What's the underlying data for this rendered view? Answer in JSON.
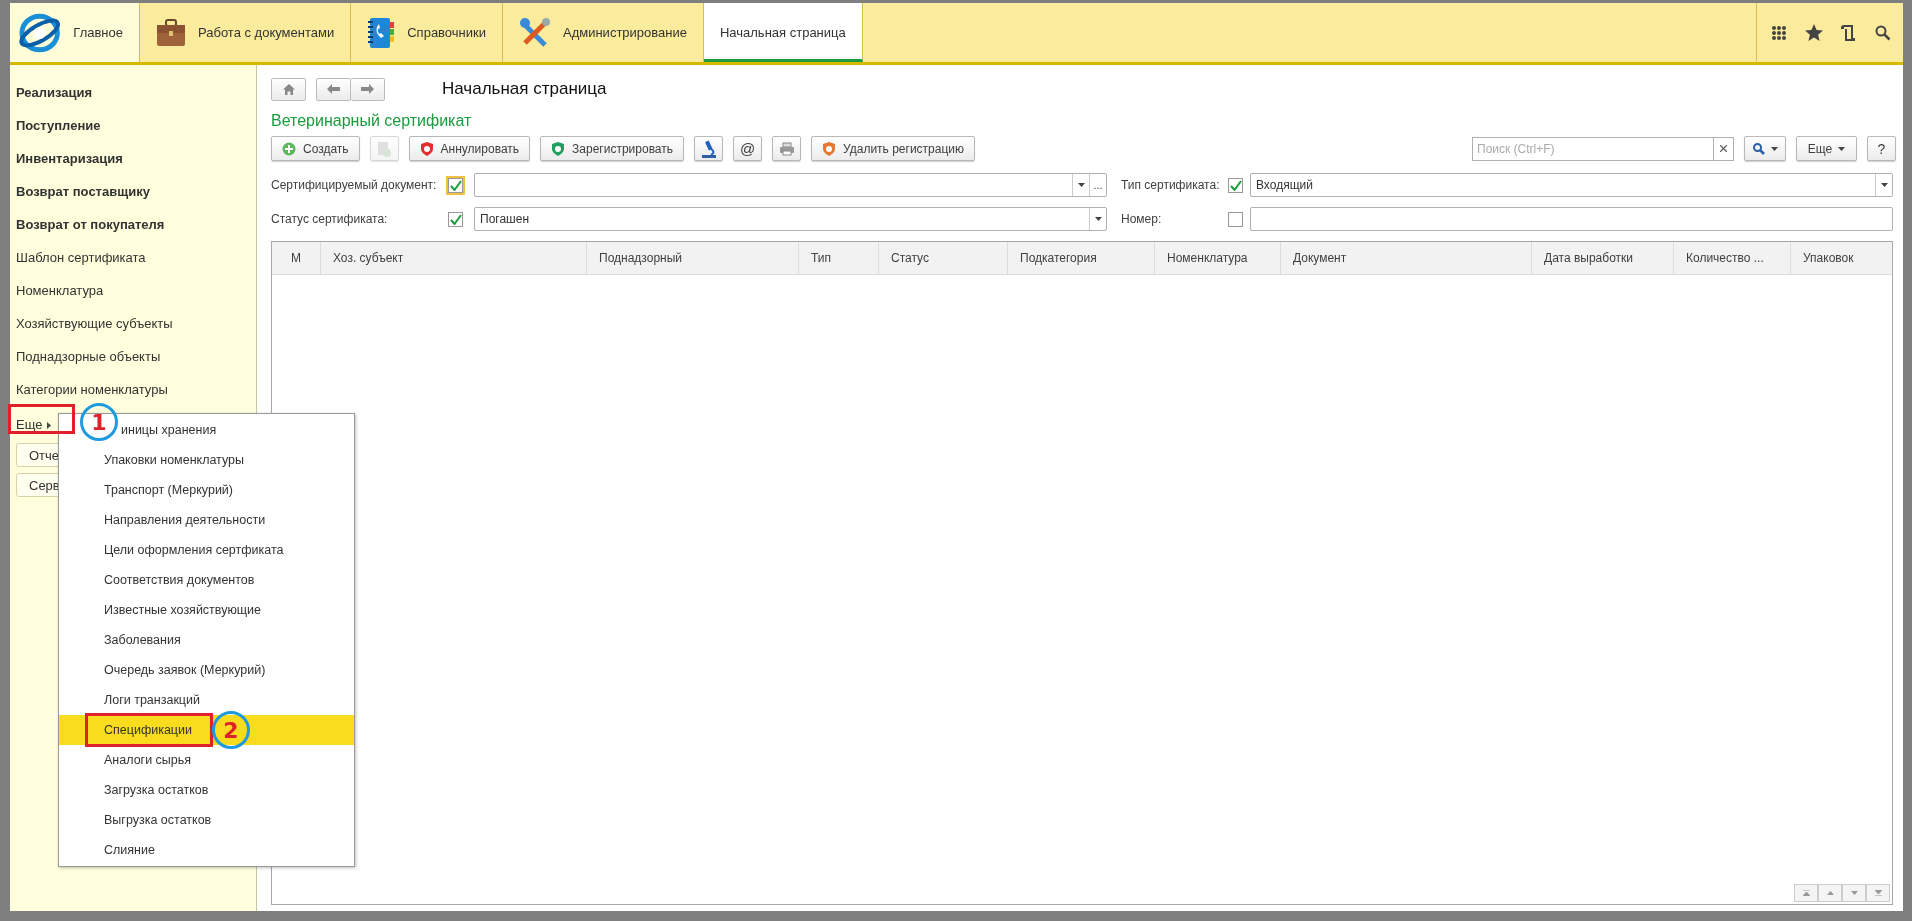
{
  "sections": [
    {
      "label": "Главное",
      "kind": "home",
      "selected": false
    },
    {
      "label": "Работа с документами",
      "kind": "briefcase",
      "selected": false
    },
    {
      "label": "Справочники",
      "kind": "phonebook",
      "selected": false
    },
    {
      "label": "Администрирование",
      "kind": "tools",
      "selected": false
    },
    {
      "label": "Начальная страница",
      "kind": "page",
      "selected": true
    }
  ],
  "sidebar": {
    "items": [
      {
        "label": "Реализация",
        "kind": "document"
      },
      {
        "label": "Поступление",
        "kind": "document"
      },
      {
        "label": "Инвентаризация",
        "kind": "document"
      },
      {
        "label": "Возврат поставщику",
        "kind": "document"
      },
      {
        "label": "Возврат от покупателя",
        "kind": "document"
      },
      {
        "label": "Шаблон сертификата",
        "kind": "catalog"
      },
      {
        "label": "Номенклатура",
        "kind": "catalog"
      },
      {
        "label": "Хозяйствующие субъекты",
        "kind": "catalog"
      },
      {
        "label": "Поднадзорные объекты",
        "kind": "catalog"
      },
      {
        "label": "Категории номенклатуры",
        "kind": "catalog"
      }
    ],
    "more": "Еще",
    "buttons": [
      "Отче",
      "Серв"
    ]
  },
  "page": {
    "title": "Начальная страница"
  },
  "form": {
    "title": "Ветеринарный сертификат",
    "commands": [
      {
        "kind": "create",
        "label": "Создать",
        "disabled": false
      },
      {
        "kind": "copy",
        "disabled": true
      },
      {
        "kind": "cancel",
        "label": "Аннулировать",
        "disabled": false
      },
      {
        "kind": "register",
        "label": "Зарегистрировать",
        "disabled": false
      },
      {
        "kind": "microscope",
        "disabled": false
      },
      {
        "kind": "email",
        "label": "@",
        "disabled": false
      },
      {
        "kind": "print",
        "disabled": false
      },
      {
        "kind": "unregister",
        "label": "Удалить регистрацию",
        "disabled": false
      }
    ],
    "search": {
      "placeholder": "Поиск (Ctrl+F)"
    },
    "more_button": "Еще",
    "help_button": "?",
    "filters": [
      {
        "label": "Сертифицируемый документ:",
        "checked": true,
        "focused": true,
        "kind": "choice",
        "select_button": "..."
      },
      {
        "label": "Тип сертификата:",
        "checked": true,
        "focused": false,
        "kind": "choice",
        "value": "Входящий"
      },
      {
        "label": "Статус сертификата:",
        "checked": true,
        "focused": false,
        "kind": "choice",
        "value": "Погашен"
      },
      {
        "label": "Номер:",
        "checked": false,
        "focused": false,
        "kind": "text"
      }
    ],
    "table": {
      "columns": [
        "М",
        "Хоз. субъект",
        "Поднадзорный",
        "Тип",
        "Статус",
        "Подкатегория",
        "Номенклатура",
        "Документ",
        "Дата выработки",
        "Количество ...",
        "Упаковок"
      ]
    }
  },
  "popup_menu": {
    "items": [
      {
        "label": "иницы хранения",
        "selected": false,
        "covered": true
      },
      {
        "label": "Упаковки номенклатуры",
        "selected": false,
        "covered": false
      },
      {
        "label": "Транспорт (Меркурий)",
        "selected": false,
        "covered": false
      },
      {
        "label": "Направления деятельности",
        "selected": false,
        "covered": false
      },
      {
        "label": "Цели оформления сертфиката",
        "selected": false,
        "covered": false
      },
      {
        "label": "Соответствия документов",
        "selected": false,
        "covered": false
      },
      {
        "label": "Известные хозяйствующие",
        "selected": false,
        "covered": false
      },
      {
        "label": "Заболевания",
        "selected": false,
        "covered": false
      },
      {
        "label": "Очередь заявок (Меркурий)",
        "selected": false,
        "covered": false
      },
      {
        "label": "Логи транзакций",
        "selected": false,
        "covered": false
      },
      {
        "label": "Спецификации",
        "selected": true,
        "covered": false
      },
      {
        "label": "Аналоги сырья",
        "selected": false,
        "covered": false
      },
      {
        "label": "Загрузка остатков",
        "selected": false,
        "covered": false
      },
      {
        "label": "Выгрузка остатков",
        "selected": false,
        "covered": false
      },
      {
        "label": "Слияние",
        "selected": false,
        "covered": false
      }
    ]
  },
  "callouts": [
    {
      "label": "1"
    },
    {
      "label": "2"
    }
  ]
}
